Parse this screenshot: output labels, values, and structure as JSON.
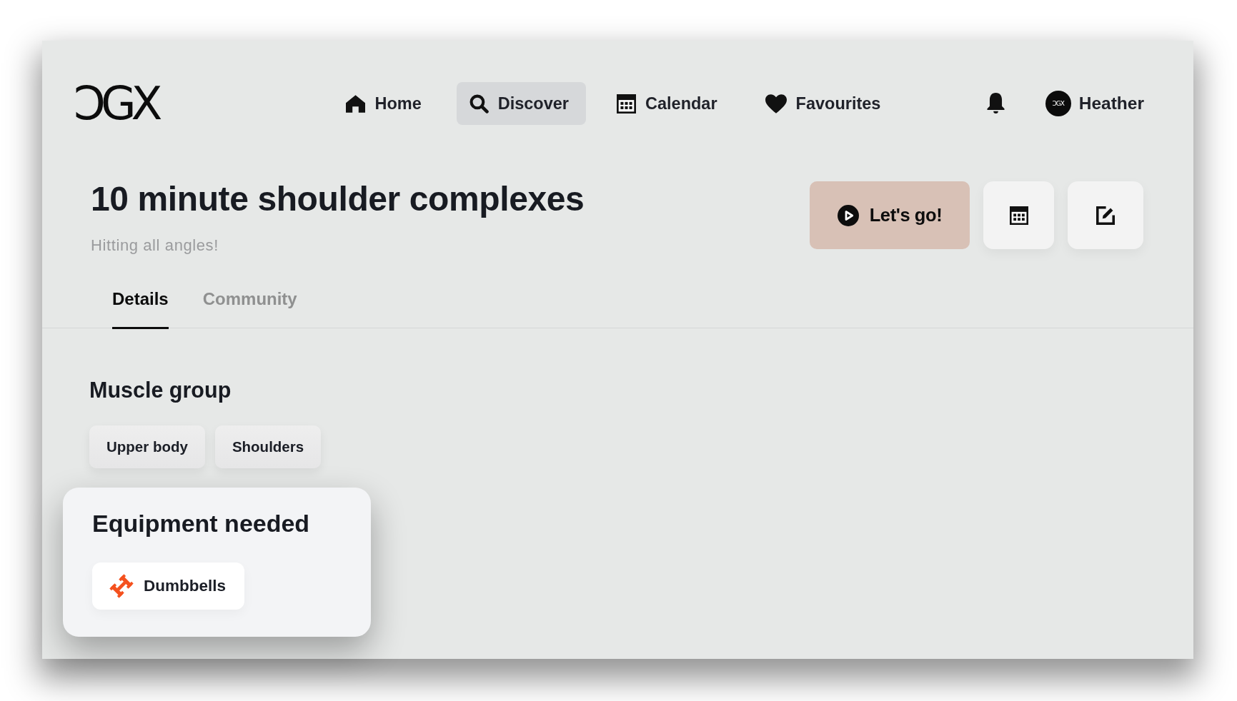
{
  "header": {
    "logo": "ƆGX",
    "nav": [
      {
        "kind": "home",
        "label": "Home",
        "selected": false
      },
      {
        "kind": "discover",
        "label": "Discover",
        "selected": true
      },
      {
        "kind": "calendar",
        "label": "Calendar",
        "selected": false
      },
      {
        "kind": "favourites",
        "label": "Favourites",
        "selected": false
      }
    ],
    "user": {
      "avatar_text": "ƆGX",
      "name": "Heather"
    }
  },
  "workout": {
    "title": "10 minute shoulder complexes",
    "subtitle": "Hitting all angles!",
    "actions": [
      {
        "kind": "start",
        "label": "Let's go!"
      },
      {
        "kind": "schedule"
      },
      {
        "kind": "edit"
      }
    ]
  },
  "tabs": [
    {
      "label": "Details",
      "selected": true
    },
    {
      "label": "Community",
      "selected": false
    }
  ],
  "muscle_group": {
    "heading": "Muscle group",
    "tags": [
      "Upper body",
      "Shoulders"
    ]
  },
  "equipment": {
    "heading": "Equipment needed",
    "items": [
      "Dumbbells"
    ]
  }
}
